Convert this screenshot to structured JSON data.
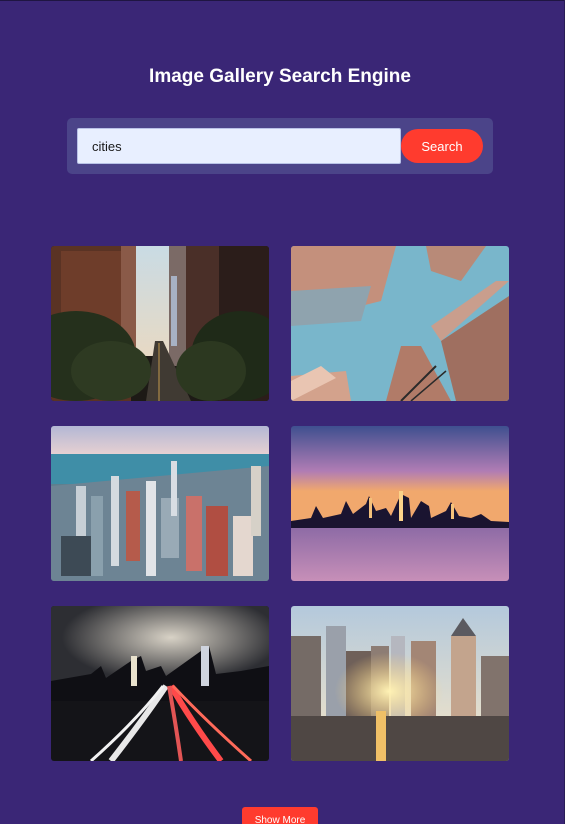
{
  "header": {
    "title": "Image Gallery Search Engine"
  },
  "search": {
    "value": "cities",
    "button_label": "Search"
  },
  "gallery": {
    "images": [
      {
        "alt": "city-street-trees"
      },
      {
        "alt": "skyscrapers-looking-up"
      },
      {
        "alt": "coastal-city-aerial"
      },
      {
        "alt": "skyline-sunset-water"
      },
      {
        "alt": "highway-light-trails-night"
      },
      {
        "alt": "city-sunrise-aerial"
      }
    ]
  },
  "footer": {
    "show_more_label": "Show More"
  },
  "colors": {
    "background": "#3a2676",
    "accent": "#ff3b2e",
    "panel": "#4b4489"
  }
}
